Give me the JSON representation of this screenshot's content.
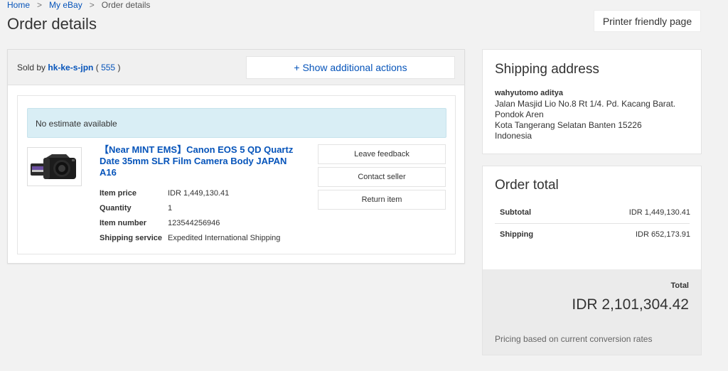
{
  "breadcrumb": {
    "items": [
      "Home",
      "My eBay",
      "Order details"
    ],
    "separator": ">"
  },
  "page_title": "Order details",
  "printer_button": "Printer friendly page",
  "order": {
    "sold_by_label": "Sold by",
    "seller": "hk-ke-s-jpn",
    "feedback_open": "(",
    "feedback_score": "555",
    "feedback_close": ")",
    "show_actions": "+ Show additional actions",
    "estimate": "No estimate available",
    "item": {
      "title": "【Near MINT EMS】Canon EOS 5 QD Quartz Date 35mm SLR Film Camera Body JAPAN A16",
      "rows": [
        {
          "label": "Item price",
          "value": "IDR 1,449,130.41"
        },
        {
          "label": "Quantity",
          "value": "1"
        },
        {
          "label": "Item number",
          "value": "123544256946"
        },
        {
          "label": "Shipping service",
          "value": "Expedited International Shipping"
        }
      ]
    },
    "actions": [
      "Leave feedback",
      "Contact seller",
      "Return item"
    ]
  },
  "shipping": {
    "heading": "Shipping address",
    "name": "wahyutomo aditya",
    "lines": [
      "Jalan Masjid Lio No.8 Rt 1/4. Pd. Kacang Barat.",
      "Pondok Aren",
      "Kota Tangerang Selatan Banten 15226",
      "Indonesia"
    ]
  },
  "totals": {
    "heading": "Order total",
    "subtotal_label": "Subtotal",
    "subtotal_value": "IDR 1,449,130.41",
    "shipping_label": "Shipping",
    "shipping_value": "IDR 652,173.91",
    "total_label": "Total",
    "total_value": "IDR 2,101,304.42",
    "note": "Pricing based on current conversion rates"
  },
  "colors": {
    "link": "#0654ba",
    "estimate_bg": "#d9eef5",
    "page_bg": "#f2f2f2"
  }
}
